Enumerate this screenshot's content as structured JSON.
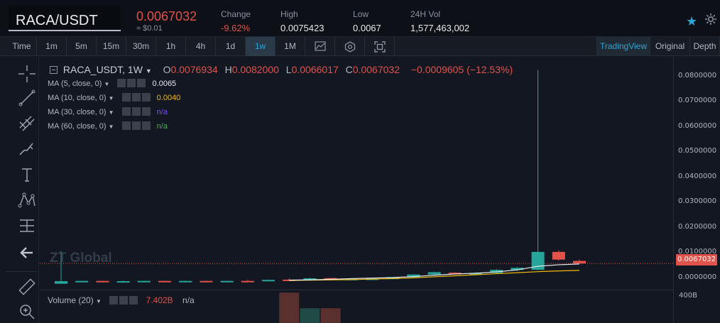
{
  "header": {
    "symbol": "RACA/USDT",
    "price": "0.0067032",
    "usd": "≈ $0.01",
    "stats": [
      {
        "label": "Change",
        "value": "-9.62%",
        "negative": true
      },
      {
        "label": "High",
        "value": "0.0075423",
        "negative": false
      },
      {
        "label": "Low",
        "value": "0.0067",
        "negative": false
      },
      {
        "label": "24H Vol",
        "value": "1,577,463,002",
        "negative": false
      }
    ],
    "star_icon": "star-icon",
    "settings_icon": "settings-icon"
  },
  "toolbar": {
    "intervals": [
      "Time",
      "1m",
      "5m",
      "15m",
      "30m",
      "1h",
      "4h",
      "1d",
      "1w",
      "1M"
    ],
    "active_interval": "1w",
    "icons": [
      "line-chart-icon",
      "indicator-icon",
      "fullscreen-icon"
    ],
    "views": [
      "TradingView",
      "Original",
      "Depth"
    ],
    "active_view": "TradingView"
  },
  "legend": {
    "title": "RACA_USDT, 1W",
    "o_label": "O",
    "o": "0.0076934",
    "h_label": "H",
    "h": "0.0082000",
    "l_label": "L",
    "l": "0.0066017",
    "c_label": "C",
    "c": "0.0067032",
    "change": "−0.0009605 (−12.53%)",
    "ma": [
      {
        "label": "MA (5, close, 0)",
        "value": "0.0065",
        "color": "#e8eaee"
      },
      {
        "label": "MA (10, close, 0)",
        "value": "0.0040",
        "color": "#f0b90b"
      },
      {
        "label": "MA (30, close, 0)",
        "value": "n/a",
        "color": "#7c4dff"
      },
      {
        "label": "MA (60, close, 0)",
        "value": "n/a",
        "color": "#4caf50"
      }
    ]
  },
  "watermark": "ZT Global",
  "price_axis": {
    "ticks": [
      "0.0800000",
      "0.0700000",
      "0.0600000",
      "0.0500000",
      "0.0400000",
      "0.0300000",
      "0.0200000",
      "0.0100000",
      "0.0000000"
    ],
    "last_price_tag": "0.0067032"
  },
  "volume": {
    "label": "Volume (20)",
    "value": "7.402B",
    "na": "n/a",
    "axis_label": "400B"
  },
  "left_tools": [
    "crosshair-icon",
    "trendline-icon",
    "fib-icon",
    "brush-icon",
    "text-icon",
    "pattern-icon",
    "measure-icon",
    "back-arrow-icon",
    "ruler-icon",
    "zoom-icon"
  ],
  "colors": {
    "up": "#26a69a",
    "down": "#e0524a",
    "accent": "#2aa6d6"
  },
  "chart_data": {
    "type": "candlestick",
    "interval": "1w",
    "ylim": [
      -0.0035,
      0.085
    ],
    "candles": [
      {
        "o": -0.0012,
        "h": 0.0115,
        "l": -0.0012,
        "c": -0.0002
      },
      {
        "o": -0.0002,
        "h": 0.0,
        "l": -0.0004,
        "c": -0.0001
      },
      {
        "o": -0.0001,
        "h": 0.0,
        "l": -0.0002,
        "c": -0.0002
      },
      {
        "o": -0.0002,
        "h": 0.0,
        "l": -0.0003,
        "c": -0.0002
      },
      {
        "o": -0.0002,
        "h": 0.0,
        "l": -0.0003,
        "c": -0.0001
      },
      {
        "o": -0.0001,
        "h": 0.0,
        "l": -0.0002,
        "c": -0.0002
      },
      {
        "o": -0.0002,
        "h": 0.0,
        "l": -0.0003,
        "c": -0.0001
      },
      {
        "o": -0.0001,
        "h": 0.0,
        "l": -0.0002,
        "c": -0.0002
      },
      {
        "o": -0.0002,
        "h": 0.0,
        "l": -0.0003,
        "c": -0.0001
      },
      {
        "o": -0.0001,
        "h": 0.0003,
        "l": -0.0002,
        "c": -0.0002
      },
      {
        "o": -0.0002,
        "h": 0.0004,
        "l": -0.0003,
        "c": 0.0003
      },
      {
        "o": 0.0004,
        "h": 0.0009,
        "l": 0.0002,
        "c": 0.0002
      },
      {
        "o": 0.0002,
        "h": 0.0011,
        "l": 0.0001,
        "c": 0.0009
      },
      {
        "o": 0.001,
        "h": 0.0011,
        "l": 0.0004,
        "c": 0.0006
      },
      {
        "o": 0.0007,
        "h": 0.0008,
        "l": 0.0006,
        "c": 0.0007
      },
      {
        "o": 0.0007,
        "h": 0.0009,
        "l": 0.0006,
        "c": 0.0008
      },
      {
        "o": 0.0006,
        "h": 0.0015,
        "l": 0.0005,
        "c": 0.0014
      },
      {
        "o": 0.0013,
        "h": 0.0025,
        "l": 0.0012,
        "c": 0.0024
      },
      {
        "o": 0.0024,
        "h": 0.0035,
        "l": 0.002,
        "c": 0.0033
      },
      {
        "o": 0.0031,
        "h": 0.0033,
        "l": 0.0025,
        "c": 0.0025
      },
      {
        "o": 0.0025,
        "h": 0.0032,
        "l": 0.0024,
        "c": 0.003
      },
      {
        "o": 0.003,
        "h": 0.0045,
        "l": 0.0028,
        "c": 0.0042
      },
      {
        "o": 0.0042,
        "h": 0.0052,
        "l": 0.0038,
        "c": 0.005
      },
      {
        "o": 0.0042,
        "h": 0.082,
        "l": 0.0041,
        "c": 0.0112
      },
      {
        "o": 0.0112,
        "h": 0.0118,
        "l": 0.0078,
        "c": 0.0082
      },
      {
        "o": 0.0076934,
        "h": 0.0082,
        "l": 0.0066017,
        "c": 0.0067032
      }
    ],
    "ma5": [
      0.0002,
      0.0003,
      0.0005,
      0.0008,
      0.001,
      0.0012,
      0.0016,
      0.0021,
      0.0026,
      0.0029,
      0.0034,
      0.0042,
      0.0056,
      0.0062,
      0.0065
    ],
    "ma10": [
      0.0001,
      0.0002,
      0.0003,
      0.0004,
      0.0006,
      0.0008,
      0.0011,
      0.0015,
      0.0019,
      0.0023,
      0.0027,
      0.0031,
      0.0035,
      0.0038,
      0.004
    ],
    "volume": [
      0,
      0,
      0,
      0,
      0,
      0,
      0,
      0,
      0,
      0,
      0,
      0,
      0,
      0,
      0,
      0,
      0,
      0,
      0,
      0,
      0,
      0,
      0,
      0,
      0,
      0
    ],
    "volume_visible": [
      {
        "index": 11,
        "value": 380,
        "up": false
      },
      {
        "index": 12,
        "value": 185,
        "up": true
      },
      {
        "index": 13,
        "value": 185,
        "up": false
      }
    ]
  }
}
